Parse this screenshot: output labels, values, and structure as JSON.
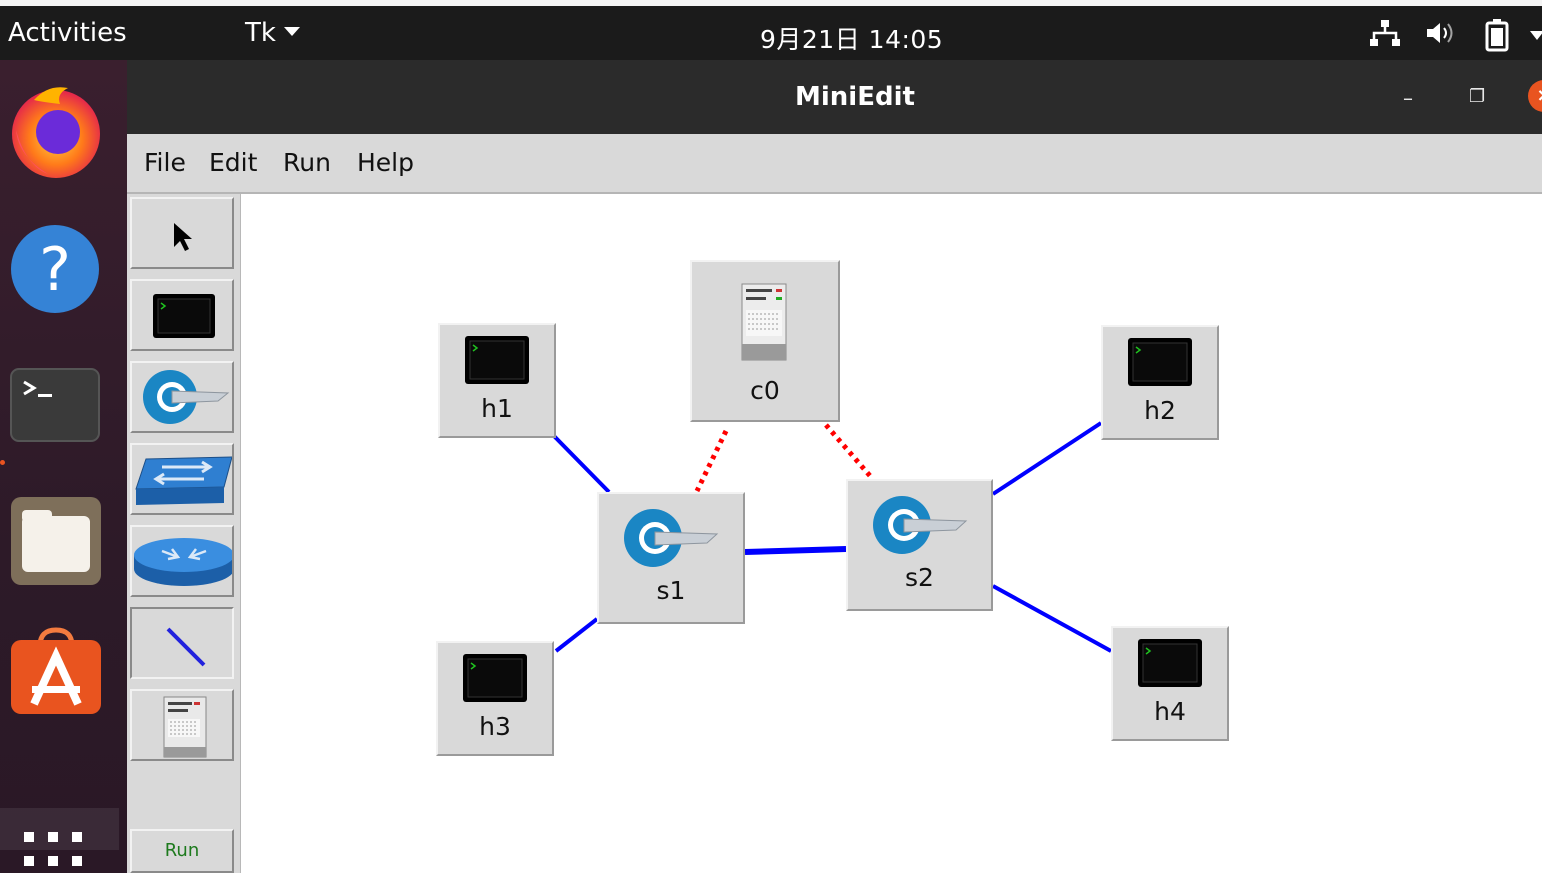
{
  "topbar": {
    "activities": "Activities",
    "app_menu": "Tk",
    "clock": "9月21日  14:05"
  },
  "dock": {
    "items": [
      "firefox-icon",
      "help-icon",
      "terminal-icon",
      "files-icon",
      "software-icon",
      "show-apps-icon"
    ]
  },
  "window": {
    "title": "MiniEdit",
    "minimize": "–",
    "maximize": "❐",
    "close": "×"
  },
  "menubar": {
    "items": [
      "File",
      "Edit",
      "Run",
      "Help"
    ]
  },
  "toolbar": {
    "tools": [
      "select-tool",
      "host-tool",
      "switch-tool",
      "legacy-switch-tool",
      "legacy-router-tool",
      "netlink-tool",
      "controller-tool"
    ],
    "selected": "netlink-tool",
    "run_label": "Run"
  },
  "colors": {
    "data_link": "#0000ff",
    "control_link": "#ff0000",
    "node_bg": "#d9d9d9"
  },
  "canvas": {
    "nodes": {
      "c0": "c0",
      "h1": "h1",
      "h2": "h2",
      "h3": "h3",
      "h4": "h4",
      "s1": "s1",
      "s2": "s2"
    }
  }
}
